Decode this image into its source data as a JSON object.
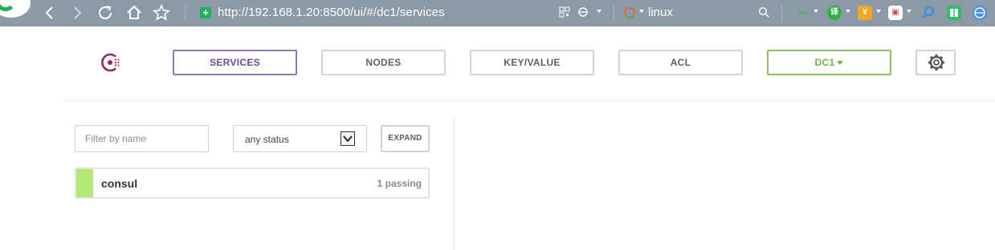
{
  "browser": {
    "url": "http://192.168.1.20:8500/ui/#/dc1/services",
    "search_engine_label": "linux",
    "icons": [
      "back-icon",
      "forward-icon",
      "refresh-icon",
      "home-icon",
      "star-icon",
      "secure-icon",
      "qr-icon",
      "ie-icon",
      "search-icon"
    ],
    "extensions": [
      {
        "name": "scissors-extension-icon",
        "color": "#3cb44b",
        "glyph": "✂"
      },
      {
        "name": "translate-extension-icon",
        "color": "#2ab34a",
        "glyph": "译"
      },
      {
        "name": "yuan-extension-icon",
        "color": "#f5a623",
        "glyph": "¥"
      },
      {
        "name": "game-extension-icon",
        "color": "#ffffff",
        "glyph": "▣"
      },
      {
        "name": "search-extension-icon",
        "color": "#3b8fe8",
        "glyph": "⌕"
      },
      {
        "name": "book-extension-icon",
        "color": "#2fbf6a",
        "glyph": "▤"
      },
      {
        "name": "globe-extension-icon",
        "color": "#4a90e2",
        "glyph": "◍"
      }
    ]
  },
  "nav": {
    "services": "SERVICES",
    "nodes": "NODES",
    "key_value": "KEY/VALUE",
    "acl": "ACL",
    "datacenter": "DC1",
    "active_tab": "services"
  },
  "filters": {
    "name_placeholder": "Filter by name",
    "status_selected": "any status",
    "expand_label": "EXPAND"
  },
  "services": [
    {
      "name": "consul",
      "checks": "1 passing",
      "status_color": "#b5e876"
    }
  ],
  "colors": {
    "accent_purple": "#694a9c",
    "accent_green": "#76b240",
    "chrome_bg": "#8c9aa8"
  }
}
